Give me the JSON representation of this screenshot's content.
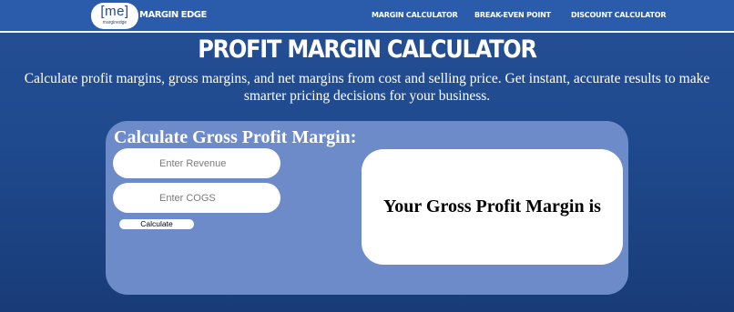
{
  "logo": {
    "mark": "[me]",
    "sub": "marginedge"
  },
  "brand": "MARGIN EDGE",
  "nav": {
    "items": [
      {
        "label": "MARGIN CALCULATOR"
      },
      {
        "label": "BREAK-EVEN POINT"
      },
      {
        "label": "DISCOUNT CALCULATOR"
      }
    ]
  },
  "page": {
    "title": "PROFIT MARGIN CALCULATOR",
    "intro": "Calculate profit margins, gross margins, and net margins from cost and selling price. Get instant, accurate results to make smarter pricing decisions for your business."
  },
  "calculator": {
    "heading": "Calculate Gross Profit Margin:",
    "revenue_placeholder": "Enter Revenue",
    "cogs_placeholder": "Enter COGS",
    "button_label": "Calculate",
    "result_label": "Your Gross Profit Margin is"
  },
  "colors": {
    "background": "#1f4a8e",
    "navbar": "#2a5cab",
    "card": "#6d8bc8",
    "result_box": "#ffffff"
  }
}
